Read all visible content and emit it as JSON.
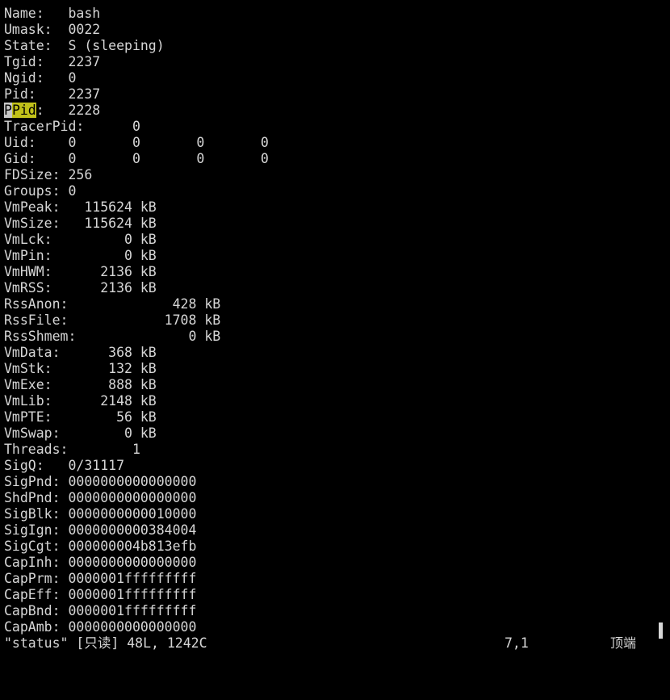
{
  "lines": [
    "Name:   bash",
    "Umask:  0022",
    "State:  S (sleeping)",
    "Tgid:   2237",
    "Ngid:   0",
    "Pid:    2237",
    "PPid:   2228",
    "TracerPid:      0",
    "Uid:    0       0       0       0",
    "Gid:    0       0       0       0",
    "FDSize: 256",
    "Groups: 0",
    "VmPeak:   115624 kB",
    "VmSize:   115624 kB",
    "VmLck:         0 kB",
    "VmPin:         0 kB",
    "VmHWM:      2136 kB",
    "VmRSS:      2136 kB",
    "RssAnon:             428 kB",
    "RssFile:            1708 kB",
    "RssShmem:              0 kB",
    "VmData:      368 kB",
    "VmStk:       132 kB",
    "VmExe:       888 kB",
    "VmLib:      2148 kB",
    "VmPTE:        56 kB",
    "VmSwap:        0 kB",
    "Threads:        1",
    "SigQ:   0/31117",
    "SigPnd: 0000000000000000",
    "ShdPnd: 0000000000000000",
    "SigBlk: 0000000000010000",
    "SigIgn: 0000000000384004",
    "SigCgt: 000000004b813efb",
    "CapInh: 0000000000000000",
    "CapPrm: 0000001fffffffff",
    "CapEff: 0000001fffffffff",
    "CapBnd: 0000001fffffffff",
    "CapAmb: 0000000000000000"
  ],
  "highlight": {
    "cursor_char": "P",
    "match_text": "Pid",
    "rest": ":   2228"
  },
  "status": {
    "file_info": "\"status\" [只读] 48L, 1242C",
    "cursor_pos": "7,1",
    "scroll_pos": "顶端"
  },
  "colors": {
    "background": "#000000",
    "foreground": "#d6d6d6",
    "search_highlight": "#c2c21a",
    "cursor": "#c8c8c8"
  }
}
